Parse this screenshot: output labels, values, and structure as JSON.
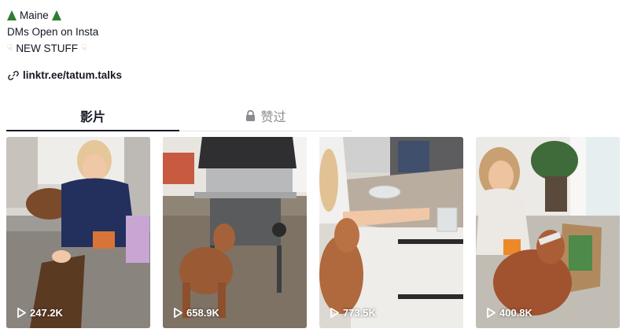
{
  "bio": {
    "line1": "Maine",
    "line2": "DMs Open on Insta",
    "line3": "NEW STUFF"
  },
  "link": {
    "text": "linktr.ee/tatum.talks"
  },
  "tabs": [
    {
      "label": "影片",
      "active": true
    },
    {
      "label": "赞过",
      "locked": true
    }
  ],
  "videos": [
    {
      "views": "247.2K"
    },
    {
      "views": "658.9K"
    },
    {
      "views": "773.5K"
    },
    {
      "views": "400.8K"
    }
  ],
  "icons": {
    "bio_emoji_1": "evergreen-tree-icon",
    "bio_emoji_2": "pointing-down-hand-icon",
    "link": "link-icon",
    "liked_tab": "lock-icon",
    "views": "play-icon"
  },
  "colors": {
    "text": "#161823",
    "muted": "#8a8b91",
    "divider": "#e3e3e4"
  }
}
